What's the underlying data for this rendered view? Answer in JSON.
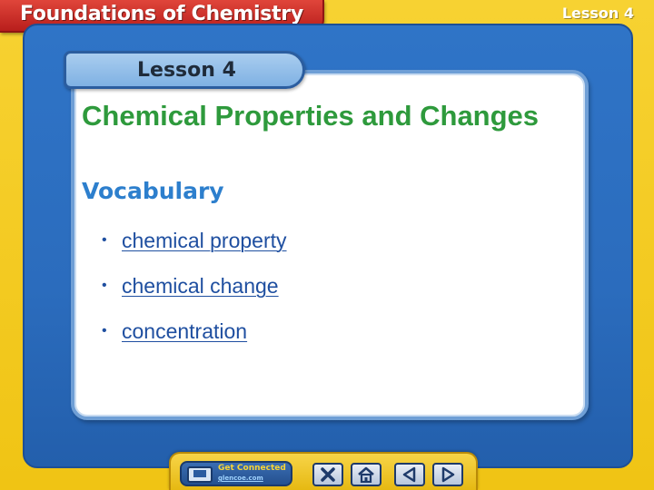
{
  "header": {
    "title": "Foundations of Chemistry",
    "lesson_corner": "Lesson 4"
  },
  "lesson_tab": {
    "label": "Lesson 4"
  },
  "main": {
    "heading": "Chemical Properties and Changes",
    "vocab_title": "Vocabulary",
    "vocab_items": [
      {
        "bullet": "•",
        "label": "chemical property"
      },
      {
        "bullet": "•",
        "label": "chemical change"
      },
      {
        "bullet": "•",
        "label": "concentration"
      }
    ]
  },
  "nav": {
    "get_connected_label": "Get Connected",
    "get_connected_url": "glencoe.com",
    "icons": [
      "close-icon",
      "home-icon",
      "previous-icon",
      "next-icon"
    ]
  },
  "colors": {
    "frame_yellow": "#f0c414",
    "title_red": "#b81e1c",
    "board_blue": "#2b6cbd",
    "heading_green": "#2e9a3c",
    "vocab_blue": "#2d7fcd",
    "link_blue": "#1f4fa0"
  }
}
